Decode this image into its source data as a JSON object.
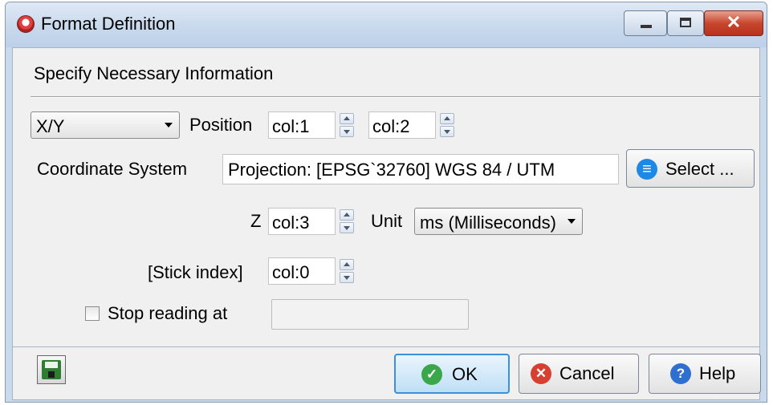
{
  "window": {
    "title": "Format Definition"
  },
  "header": {
    "label": "Specify Necessary Information"
  },
  "position": {
    "type_value": "X/Y",
    "label": "Position",
    "col_x": "col:1",
    "col_y": "col:2"
  },
  "coordinate_system": {
    "label": "Coordinate System",
    "value": "Projection: [EPSG`32760] WGS 84 / UTM",
    "select_label": "Select ..."
  },
  "z": {
    "label": "Z",
    "col": "col:3",
    "unit_label": "Unit",
    "unit_value": "ms (Milliseconds)"
  },
  "stick_index": {
    "label": "[Stick index]",
    "col": "col:0"
  },
  "stop_reading": {
    "label": "Stop reading at",
    "checked": false,
    "value": ""
  },
  "footer": {
    "ok_label": "OK",
    "cancel_label": "Cancel",
    "help_label": "Help"
  },
  "colors": {
    "ok": "#3aa84a",
    "cancel": "#d64030",
    "help": "#2f6fd0",
    "select": "#1e88e5"
  }
}
